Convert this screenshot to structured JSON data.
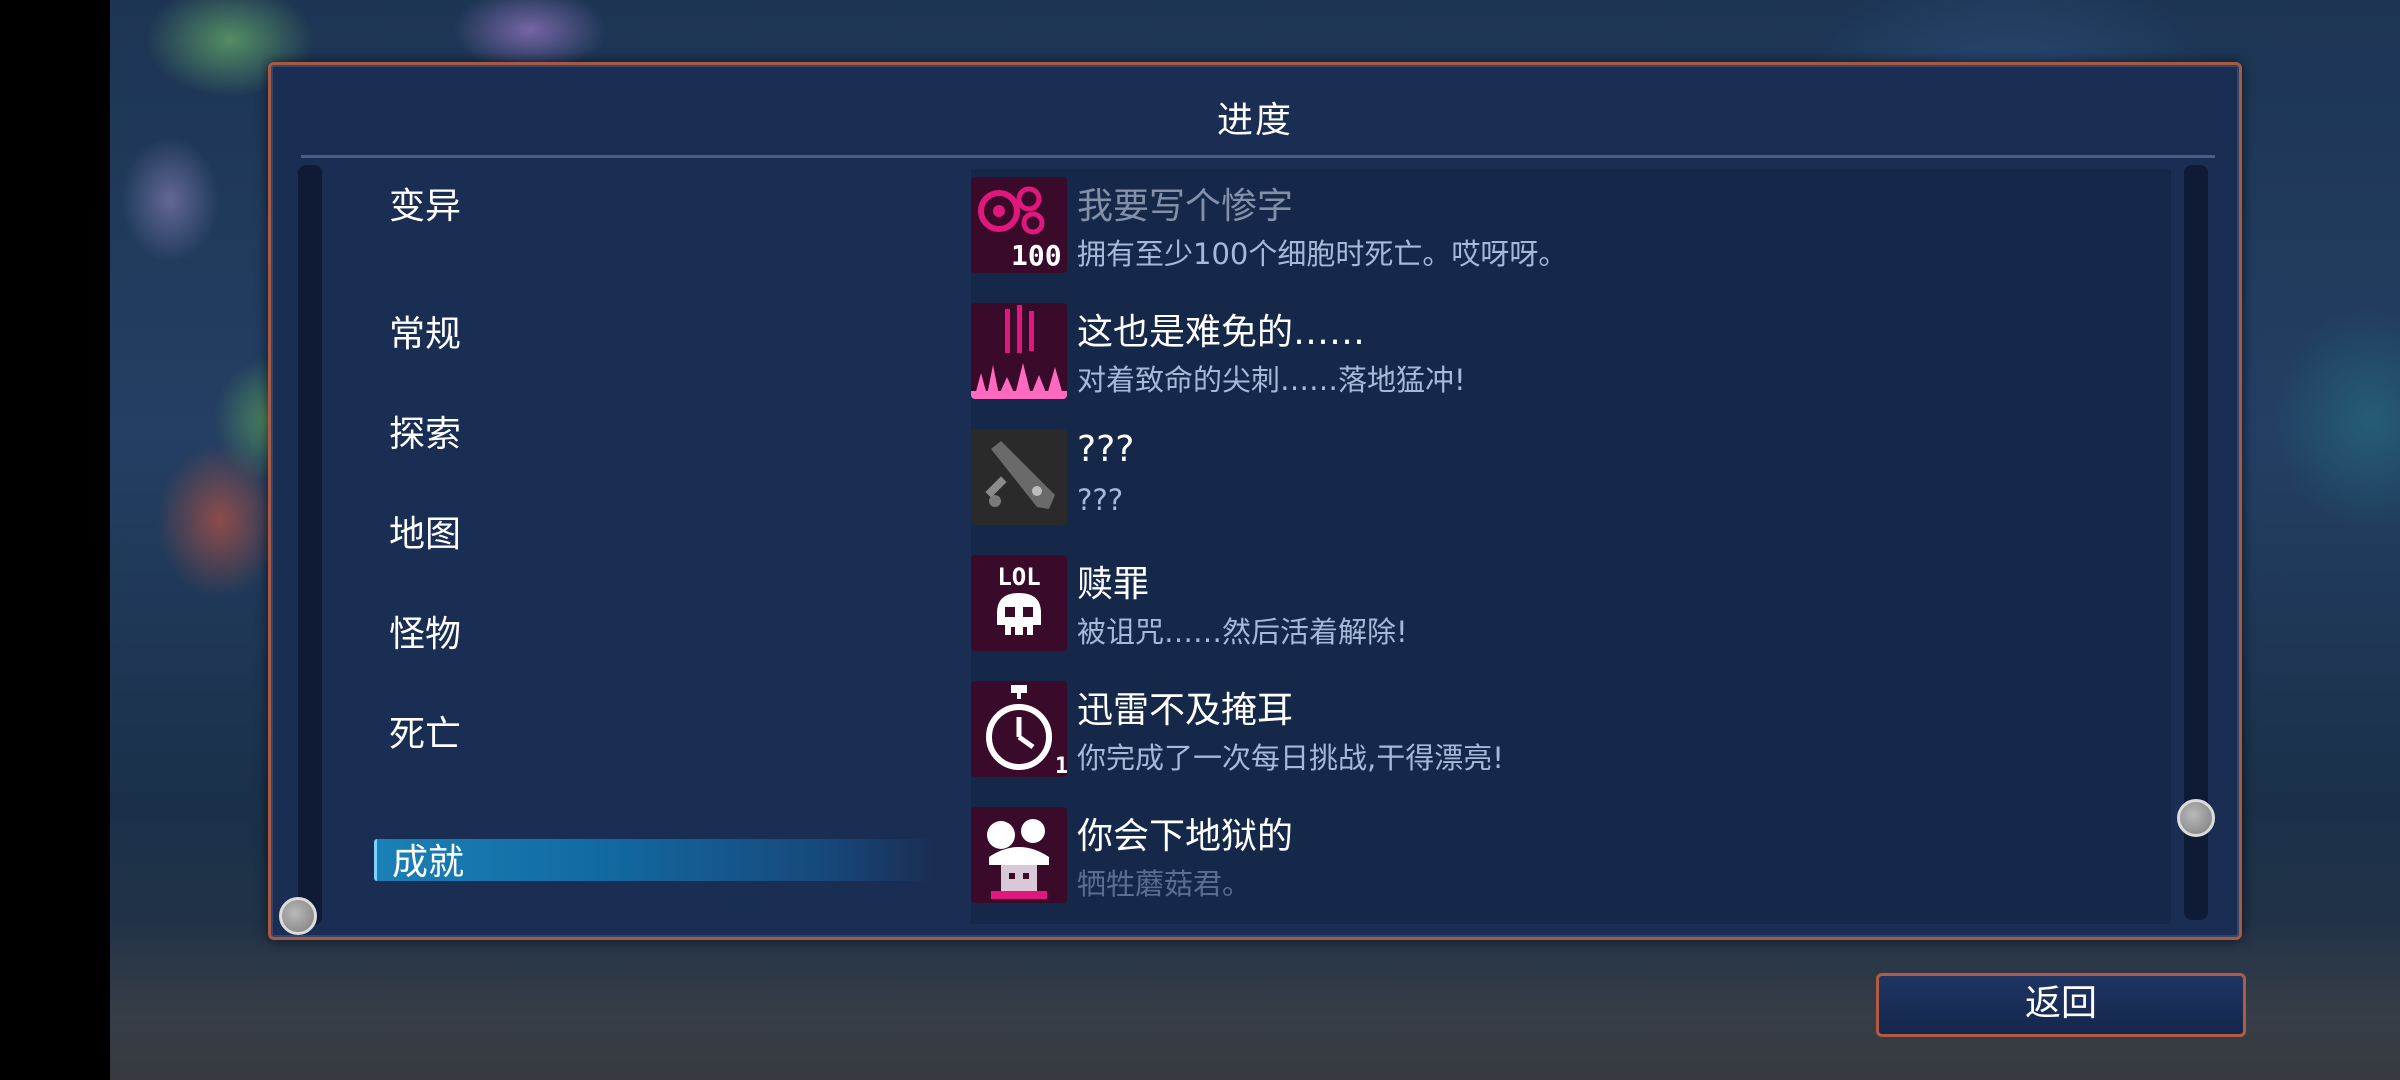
{
  "panel": {
    "title": "进度"
  },
  "categories": [
    {
      "label": "变异",
      "active": false
    },
    {
      "label": "常规",
      "active": false
    },
    {
      "label": "探索",
      "active": false
    },
    {
      "label": "地图",
      "active": false
    },
    {
      "label": "怪物",
      "active": false
    },
    {
      "label": "死亡",
      "active": false
    },
    {
      "label": "成就",
      "active": true
    }
  ],
  "achievements": [
    {
      "title": "我要写个惨字",
      "desc": "拥有至少100个细胞时死亡。哎呀呀。",
      "icon": "cells-100-icon",
      "icon_text": "100"
    },
    {
      "title": "这也是难免的……",
      "desc": "对着致命的尖刺……落地猛冲!",
      "icon": "spike-fall-icon"
    },
    {
      "title": "???",
      "desc": "???",
      "icon": "locked-sword-icon"
    },
    {
      "title": "赎罪",
      "desc": "被诅咒……然后活着解除!",
      "icon": "lol-skull-icon",
      "icon_text": "LOL"
    },
    {
      "title": "迅雷不及掩耳",
      "desc": "你完成了一次每日挑战,干得漂亮!",
      "icon": "stopwatch-icon",
      "icon_text": "1"
    },
    {
      "title": "你会下地狱的",
      "desc": "牺牲蘑菇君。",
      "icon": "mushroom-sacrifice-icon"
    }
  ],
  "back_button": {
    "label": "返回"
  },
  "colors": {
    "accent": "#e0187e",
    "panel_border": "#a65a45",
    "active_tab": "#1a80b6"
  }
}
